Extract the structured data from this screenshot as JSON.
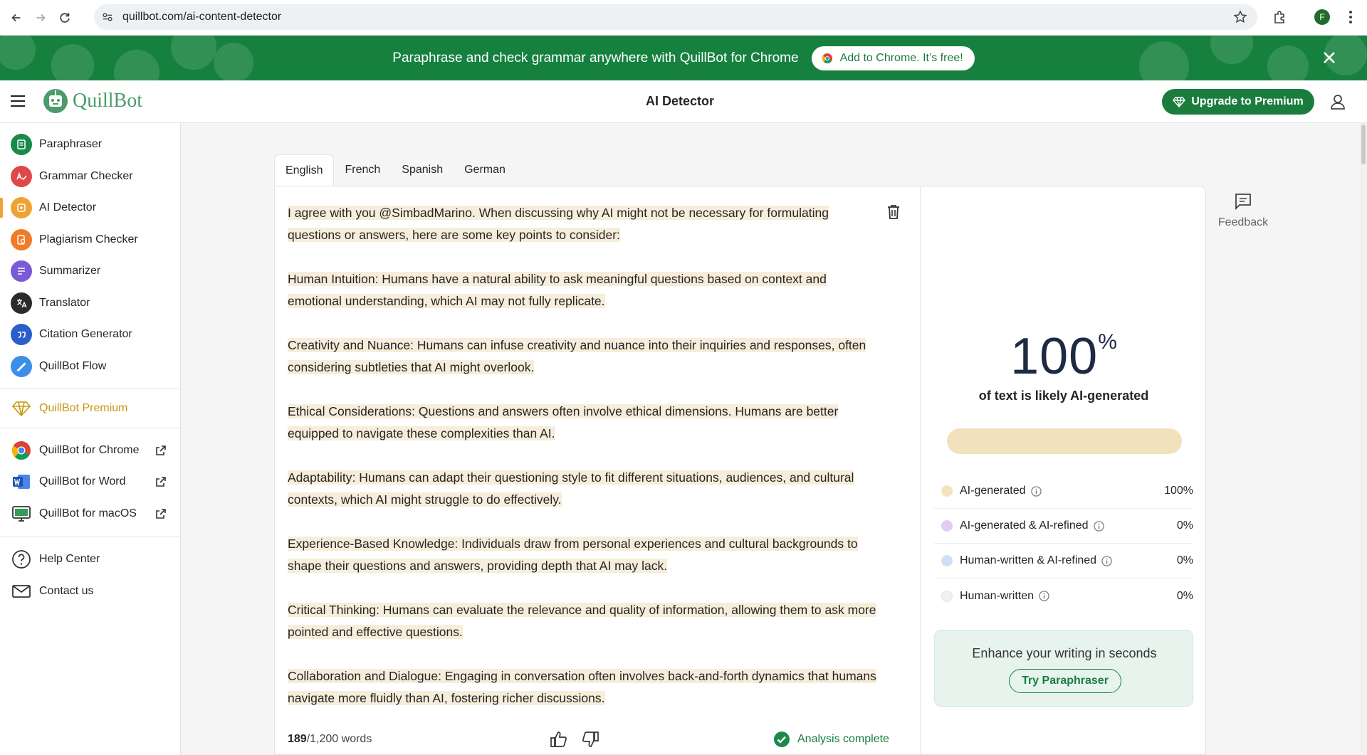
{
  "browser": {
    "url": "quillbot.com/ai-content-detector",
    "profile_initial": "F"
  },
  "promo_banner": {
    "text": "Paraphrase and check grammar anywhere with QuillBot for Chrome",
    "button_label": "Add to Chrome. It’s free!"
  },
  "header": {
    "logo_text": "QuillBot",
    "page_title": "AI Detector",
    "upgrade_label": "Upgrade to Premium"
  },
  "sidebar": {
    "items": [
      {
        "label": "Paraphraser",
        "color": "#1a8a4a"
      },
      {
        "label": "Grammar Checker",
        "color": "#e04848"
      },
      {
        "label": "AI Detector",
        "color": "#f0a235"
      },
      {
        "label": "Plagiarism Checker",
        "color": "#f07c2a"
      },
      {
        "label": "Summarizer",
        "color": "#7b5ad6"
      },
      {
        "label": "Translator",
        "color": "#2b2b2b"
      },
      {
        "label": "Citation Generator",
        "color": "#2a5fc9"
      },
      {
        "label": "QuillBot Flow",
        "color": "#3d8ee8"
      }
    ],
    "premium_label": "QuillBot Premium",
    "apps": [
      {
        "label": "QuillBot for Chrome"
      },
      {
        "label": "QuillBot for Word"
      },
      {
        "label": "QuillBot for macOS"
      }
    ],
    "help": [
      {
        "label": "Help Center"
      },
      {
        "label": "Contact us"
      }
    ]
  },
  "language_tabs": [
    "English",
    "French",
    "Spanish",
    "German"
  ],
  "editor": {
    "paragraphs": [
      "I agree with you @SimbadMarino. When discussing why AI might not be necessary for formulating questions or answers, here are some key points to consider:",
      "Human Intuition: Humans have a natural ability to ask meaningful questions based on context and emotional understanding, which AI may not fully replicate.",
      "Creativity and Nuance: Humans can infuse creativity and nuance into their inquiries and responses, often considering subtleties that AI might overlook.",
      "Ethical Considerations: Questions and answers often involve ethical dimensions. Humans are better equipped to navigate these complexities than AI.",
      "Adaptability: Humans can adapt their questioning style to fit different situations, audiences, and cultural contexts, which AI might struggle to do effectively.",
      "Experience-Based Knowledge: Individuals draw from personal experiences and cultural backgrounds to shape their questions and answers, providing depth that AI may lack.",
      "Critical Thinking: Humans can evaluate the relevance and quality of information, allowing them to ask more pointed and effective questions.",
      "Collaboration and Dialogue: Engaging in conversation often involves back-and-forth dynamics that humans navigate more fluidly than AI, fostering richer discussions."
    ],
    "word_count_current": "189",
    "word_count_limit": "/1,200 words",
    "status": "Analysis complete"
  },
  "result": {
    "percent_value": "100",
    "percent_unit": "%",
    "meter_fraction": 1.0,
    "caption": "of text is likely AI-generated",
    "legend": [
      {
        "label": "AI-generated",
        "value": "100%",
        "color": "#f3e3bd"
      },
      {
        "label": "AI-generated & AI-refined",
        "value": "0%",
        "color": "#e3cdf3"
      },
      {
        "label": "Human-written & AI-refined",
        "value": "0%",
        "color": "#cfe0f6"
      },
      {
        "label": "Human-written",
        "value": "0%",
        "color": "#f1f1f1"
      }
    ],
    "promo_text": "Enhance your writing in seconds",
    "promo_button": "Try Paraphraser"
  },
  "feedback_label": "Feedback"
}
